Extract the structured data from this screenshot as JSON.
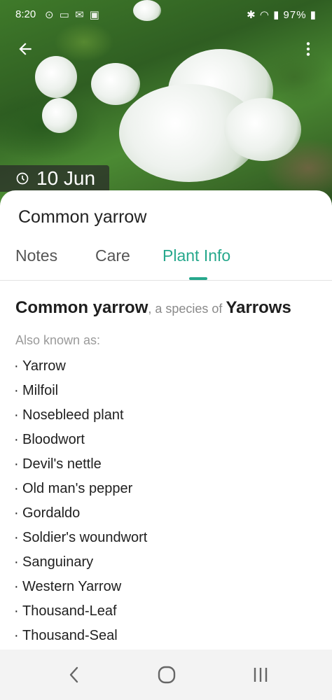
{
  "status_bar": {
    "time": "8:20",
    "battery": "97%"
  },
  "header": {
    "date": "10 Jun"
  },
  "plant": {
    "name": "Common yarrow"
  },
  "tabs": [
    {
      "label": "Notes"
    },
    {
      "label": "Care"
    },
    {
      "label": "Plant Info"
    }
  ],
  "info": {
    "species_name": "Common yarrow",
    "species_connector": ", a species of ",
    "genus": "Yarrows",
    "aka_label": "Also known as:",
    "names": [
      "Yarrow",
      "Milfoil",
      "Nosebleed plant",
      "Bloodwort",
      "Devil's nettle",
      "Old man's pepper",
      "Gordaldo",
      "Soldier's woundwort",
      "Sanguinary",
      "Western Yarrow",
      "Thousand-Leaf",
      "Thousand-Seal"
    ]
  },
  "colors": {
    "accent": "#26a88c"
  },
  "icons": {
    "back": "arrow-left-icon",
    "more": "more-vert-icon",
    "clock": "clock-icon",
    "nav_back": "chevron-left-icon",
    "nav_home": "home-circle-icon",
    "nav_recent": "recent-apps-icon"
  }
}
